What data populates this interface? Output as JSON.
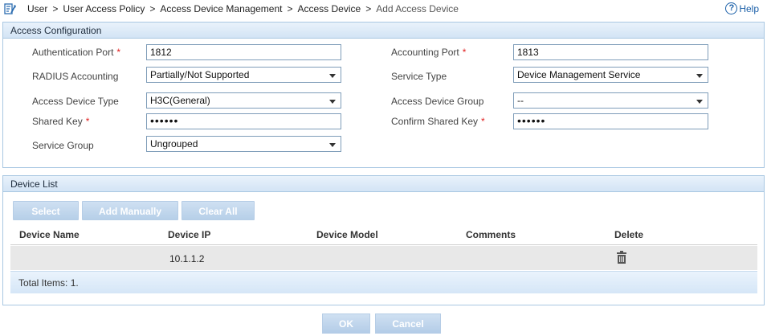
{
  "breadcrumb": {
    "items": [
      "User",
      "User Access Policy",
      "Access Device Management",
      "Access Device"
    ],
    "current": "Add Access Device",
    "separator": ">"
  },
  "help": {
    "label": "Help",
    "icon": "help-circle-icon"
  },
  "access_config": {
    "title": "Access Configuration",
    "authentication_port": {
      "label": "Authentication Port",
      "value": "1812",
      "required": "*"
    },
    "accounting_port": {
      "label": "Accounting Port",
      "value": "1813",
      "required": "*"
    },
    "radius_accounting": {
      "label": "RADIUS Accounting",
      "value": "Partially/Not Supported"
    },
    "service_type": {
      "label": "Service Type",
      "value": "Device Management Service"
    },
    "access_device_type": {
      "label": "Access Device Type",
      "value": "H3C(General)"
    },
    "access_device_group": {
      "label": "Access Device Group",
      "value": "--"
    },
    "shared_key": {
      "label": "Shared Key",
      "value": "••••••",
      "required": "*"
    },
    "confirm_shared_key": {
      "label": "Confirm Shared Key",
      "value": "••••••",
      "required": "*"
    },
    "service_group": {
      "label": "Service Group",
      "value": "Ungrouped"
    }
  },
  "device_list": {
    "title": "Device List",
    "buttons": {
      "select": "Select",
      "add_manually": "Add Manually",
      "clear_all": "Clear All"
    },
    "columns": [
      "Device Name",
      "Device IP",
      "Device Model",
      "Comments",
      "Delete"
    ],
    "rows": [
      {
        "device_name": "",
        "device_ip": "10.1.1.2",
        "device_model": "",
        "comments": "",
        "delete_icon": "trash-icon"
      }
    ],
    "total": "Total Items: 1."
  },
  "actions": {
    "ok": "OK",
    "cancel": "Cancel"
  },
  "colors": {
    "accent": "#1a5fa8",
    "panel_border": "#a9c7e2",
    "button": "#b6cfe8",
    "required": "#e02020"
  }
}
